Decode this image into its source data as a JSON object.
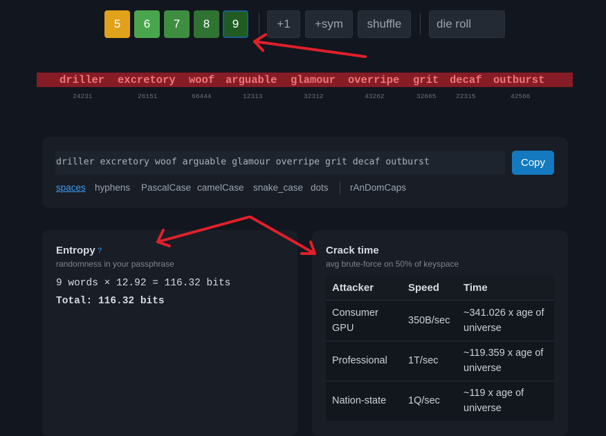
{
  "toolbar": {
    "word_counts": [
      {
        "label": "5",
        "color": "#e1a21b"
      },
      {
        "label": "6",
        "color": "#4aa64e"
      },
      {
        "label": "7",
        "color": "#3f8d41"
      },
      {
        "label": "8",
        "color": "#2f7332"
      },
      {
        "label": "9",
        "color": "#205b23"
      }
    ],
    "plus_one": "+1",
    "plus_sym": "+sym",
    "shuffle": "shuffle",
    "die_roll_placeholder": "die roll"
  },
  "passphrase": {
    "words": [
      {
        "word": "driller",
        "index": "24231"
      },
      {
        "word": "excretory",
        "index": "26151"
      },
      {
        "word": "woof",
        "index": "66444"
      },
      {
        "word": "arguable",
        "index": "12313"
      },
      {
        "word": "glamour",
        "index": "32312"
      },
      {
        "word": "overripe",
        "index": "43262"
      },
      {
        "word": "grit",
        "index": "32665"
      },
      {
        "word": "decaf",
        "index": "22315"
      },
      {
        "word": "outburst",
        "index": "42566"
      }
    ]
  },
  "output": {
    "text": "driller excretory woof arguable glamour overripe grit decaf outburst",
    "copy_label": "Copy",
    "formats": [
      "spaces",
      "hyphens",
      "PascalCase",
      "camelCase",
      "snake_case",
      "dots",
      "rAnDomCaps"
    ],
    "active_format": "spaces"
  },
  "entropy": {
    "title": "Entropy",
    "help": "?",
    "subtitle": "randomness in your passphrase",
    "formula": "9 words × 12.92 = 116.32 bits",
    "total": "Total: 116.32 bits"
  },
  "crack": {
    "title": "Crack time",
    "subtitle": "avg brute-force on 50% of keyspace",
    "headers": [
      "Attacker",
      "Speed",
      "Time"
    ],
    "rows": [
      {
        "attacker": "Consumer GPU",
        "speed": "350B/sec",
        "time": "~341.026 x age of universe"
      },
      {
        "attacker": "Professional",
        "speed": "1T/sec",
        "time": "~119.359 x age of universe"
      },
      {
        "attacker": "Nation-state",
        "speed": "1Q/sec",
        "time": "~119 x age of universe"
      }
    ]
  },
  "colors": {
    "background": "#12161e",
    "card": "#181d26",
    "accent_blue": "#1479be",
    "strip_red": "#861c26",
    "annotation_red": "#e0202a"
  }
}
